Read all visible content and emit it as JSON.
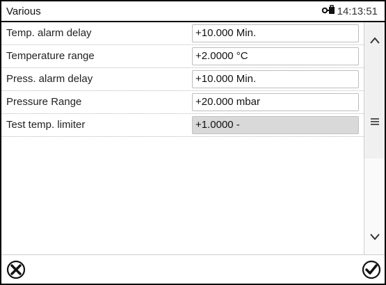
{
  "header": {
    "title": "Various",
    "time": "14:13:51",
    "status_icon": "user-login-icon"
  },
  "rows": [
    {
      "label": "Temp. alarm delay",
      "value": "+10.000 Min.",
      "editable": true
    },
    {
      "label": "Temperature range",
      "value": "+2.0000 °C",
      "editable": true
    },
    {
      "label": "Press. alarm delay",
      "value": "+10.000 Min.",
      "editable": true
    },
    {
      "label": "Pressure Range",
      "value": "+20.000 mbar",
      "editable": true
    },
    {
      "label": "Test temp. limiter",
      "value": "+1.0000 -",
      "editable": false
    }
  ],
  "scrollbar": {
    "up_icon": "chevron-up-icon",
    "thumb_icon": "menu-lines-icon",
    "down_icon": "chevron-down-icon"
  },
  "footer": {
    "cancel_icon": "cancel-icon",
    "confirm_icon": "confirm-icon"
  }
}
